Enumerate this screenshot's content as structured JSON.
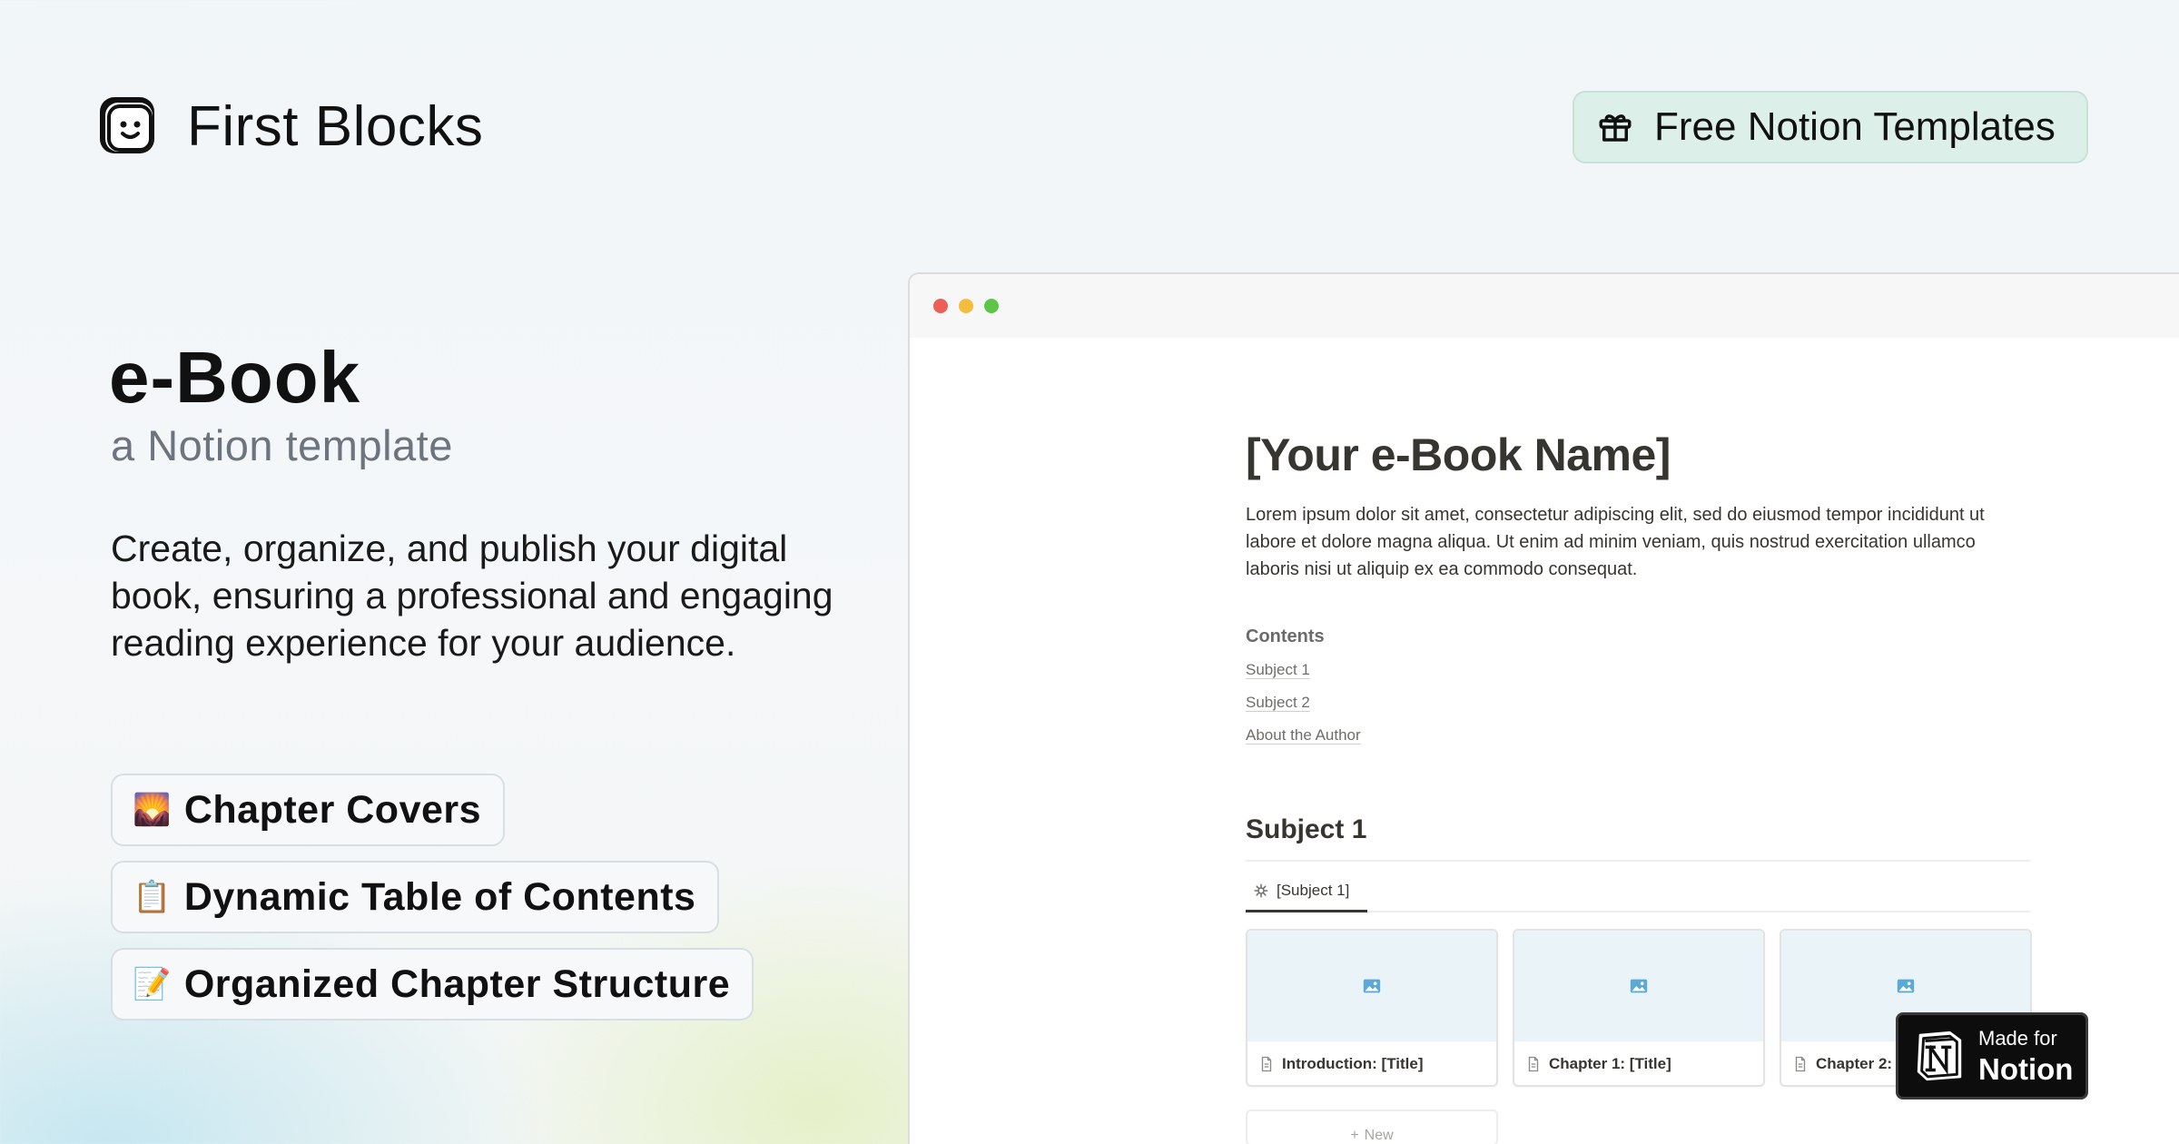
{
  "brand": {
    "name": "First Blocks",
    "logo_icon": "smiley-block-logo-icon"
  },
  "header": {
    "cta_label": "Free Notion Templates",
    "cta_icon": "gift-icon",
    "cta_bg": "#dcefe8"
  },
  "hero": {
    "title": "e-Book",
    "subtitle": "a Notion template",
    "description": "Create, organize, and publish your digital book, ensuring a professional and engaging reading experience for your audience.",
    "features": [
      {
        "emoji": "🌄",
        "label": "Chapter Covers"
      },
      {
        "emoji": "📋",
        "label": "Dynamic Table of Contents"
      },
      {
        "emoji": "📝",
        "label": "Organized Chapter Structure"
      }
    ]
  },
  "window": {
    "traffic_lights": [
      "#ec5f57",
      "#f4bd3f",
      "#5dc548"
    ],
    "doc": {
      "title": "[Your e-Book Name]",
      "body": "Lorem ipsum dolor sit amet, consectetur adipiscing elit, sed do eiusmod tempor incididunt ut labore et dolore magna aliqua. Ut enim ad minim veniam, quis nostrud exercitation ullamco laboris nisi ut aliquip ex ea commodo consequat.",
      "contents_label": "Contents",
      "toc": [
        "Subject 1",
        "Subject 2",
        "About the Author"
      ],
      "section_heading": "Subject 1",
      "tab_label": "[Subject 1]",
      "cards": [
        "Introduction: [Title]",
        "Chapter 1: [Title]",
        "Chapter 2: ["
      ],
      "new_label": "New"
    }
  },
  "badge": {
    "small": "Made for",
    "big": "Notion"
  }
}
